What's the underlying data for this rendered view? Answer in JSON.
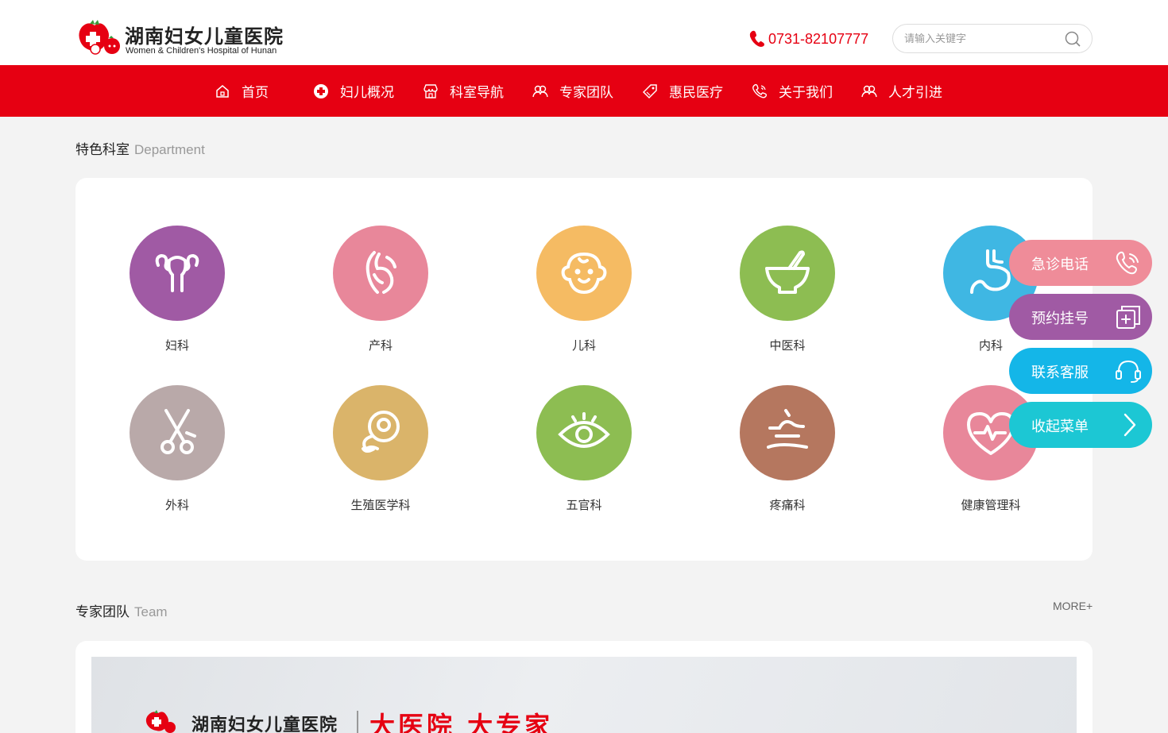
{
  "header": {
    "logo_cn": "湖南妇女儿童医院",
    "logo_en": "Women & Children's Hospital of Hunan",
    "phone": "0731-82107777",
    "search_placeholder": "请输入关键字"
  },
  "nav": [
    {
      "label": "首页",
      "icon": "home-icon"
    },
    {
      "label": "妇儿概况",
      "icon": "hospital-badge-icon"
    },
    {
      "label": "科室导航",
      "icon": "store-icon"
    },
    {
      "label": "专家团队",
      "icon": "people-icon"
    },
    {
      "label": "惠民医疗",
      "icon": "tag-icon"
    },
    {
      "label": "关于我们",
      "icon": "phone-icon"
    },
    {
      "label": "人才引进",
      "icon": "people-icon"
    }
  ],
  "departments": {
    "title_cn": "特色科室",
    "title_en": "Department",
    "items": [
      {
        "label": "妇科",
        "color": "#a05aa4",
        "icon": "uterus-icon"
      },
      {
        "label": "产科",
        "color": "#e8879a",
        "icon": "pregnancy-icon"
      },
      {
        "label": "儿科",
        "color": "#f5bb63",
        "icon": "baby-face-icon"
      },
      {
        "label": "中医科",
        "color": "#8dbd52",
        "icon": "mortar-icon"
      },
      {
        "label": "内科",
        "color": "#3fb7e3",
        "icon": "stomach-icon"
      },
      {
        "label": "外科",
        "color": "#b9a9a9",
        "icon": "scissors-icon"
      },
      {
        "label": "生殖医学科",
        "color": "#dab46a",
        "icon": "embryo-icon"
      },
      {
        "label": "五官科",
        "color": "#8dbd52",
        "icon": "eye-icon"
      },
      {
        "label": "疼痛科",
        "color": "#b5775f",
        "icon": "pain-icon"
      },
      {
        "label": "健康管理科",
        "color": "#e8879a",
        "icon": "heart-pulse-icon"
      }
    ]
  },
  "team": {
    "title_cn": "专家团队",
    "title_en": "Team",
    "more": "MORE+",
    "banner_cn": "湖南妇女儿童医院",
    "banner_slogan": "大医院 大专家"
  },
  "float_menu": [
    {
      "label": "急诊电话",
      "color": "#ef8c99",
      "icon": "phone-call-icon"
    },
    {
      "label": "预约挂号",
      "color": "#a05aa4",
      "icon": "register-icon"
    },
    {
      "label": "联系客服",
      "color": "#14b6e8",
      "icon": "headset-icon"
    },
    {
      "label": "收起菜单",
      "color": "#1cc7d4",
      "icon": "chevron-right-icon"
    }
  ],
  "colors": {
    "brand_red": "#e60012",
    "page_bg": "#f3f3f3"
  }
}
